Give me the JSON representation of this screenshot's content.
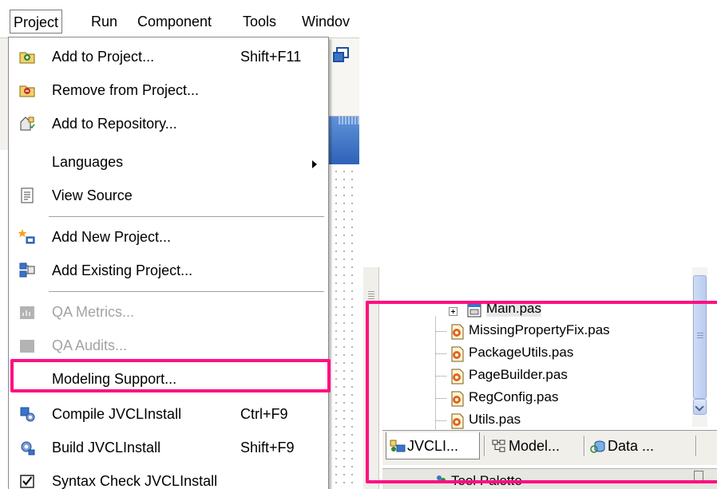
{
  "menubar": {
    "items": [
      "Project",
      "Run",
      "Component",
      "Tools",
      "Windov"
    ]
  },
  "project_menu": {
    "items": [
      {
        "label": "Add to Project...",
        "shortcut": "Shift+F11",
        "icon": "add-to-project-icon",
        "enabled": true
      },
      {
        "label": "Remove from Project...",
        "shortcut": "",
        "icon": "remove-from-project-icon",
        "enabled": true
      },
      {
        "label": "Add to Repository...",
        "shortcut": "",
        "icon": "add-to-repository-icon",
        "enabled": true
      },
      {
        "label": "Languages",
        "shortcut": "",
        "icon": "",
        "enabled": true,
        "submenu": true
      },
      {
        "label": "View Source",
        "shortcut": "",
        "icon": "view-source-icon",
        "enabled": true
      },
      {
        "label": "Add New Project...",
        "shortcut": "",
        "icon": "add-new-project-icon",
        "enabled": true
      },
      {
        "label": "Add Existing Project...",
        "shortcut": "",
        "icon": "add-existing-project-icon",
        "enabled": true
      },
      {
        "label": "QA Metrics...",
        "shortcut": "",
        "icon": "qa-metrics-icon",
        "enabled": false
      },
      {
        "label": "QA Audits...",
        "shortcut": "",
        "icon": "qa-audits-icon",
        "enabled": false
      },
      {
        "label": "Modeling Support...",
        "shortcut": "",
        "icon": "",
        "enabled": true,
        "highlighted": true
      },
      {
        "label": "Compile JVCLInstall",
        "shortcut": "Ctrl+F9",
        "icon": "compile-icon",
        "enabled": true
      },
      {
        "label": "Build JVCLInstall",
        "shortcut": "Shift+F9",
        "icon": "build-icon",
        "enabled": true
      },
      {
        "label": "Syntax Check JVCLInstall",
        "shortcut": "",
        "icon": "syntax-check-icon",
        "enabled": true
      }
    ]
  },
  "project_manager": {
    "files": [
      "Main.pas",
      "MissingPropertyFix.pas",
      "PackageUtils.pas",
      "PageBuilder.pas",
      "RegConfig.pas",
      "Utils.pas"
    ],
    "tabs": [
      "JVCLI...",
      "Model...",
      "Data ..."
    ],
    "active_tab": "JVCLI...",
    "tool_palette_title": "Tool Palette"
  },
  "colors": {
    "highlight": "#ff0f82",
    "title_bar": "#2f62b8",
    "disabled_text": "#a3a3a3"
  }
}
